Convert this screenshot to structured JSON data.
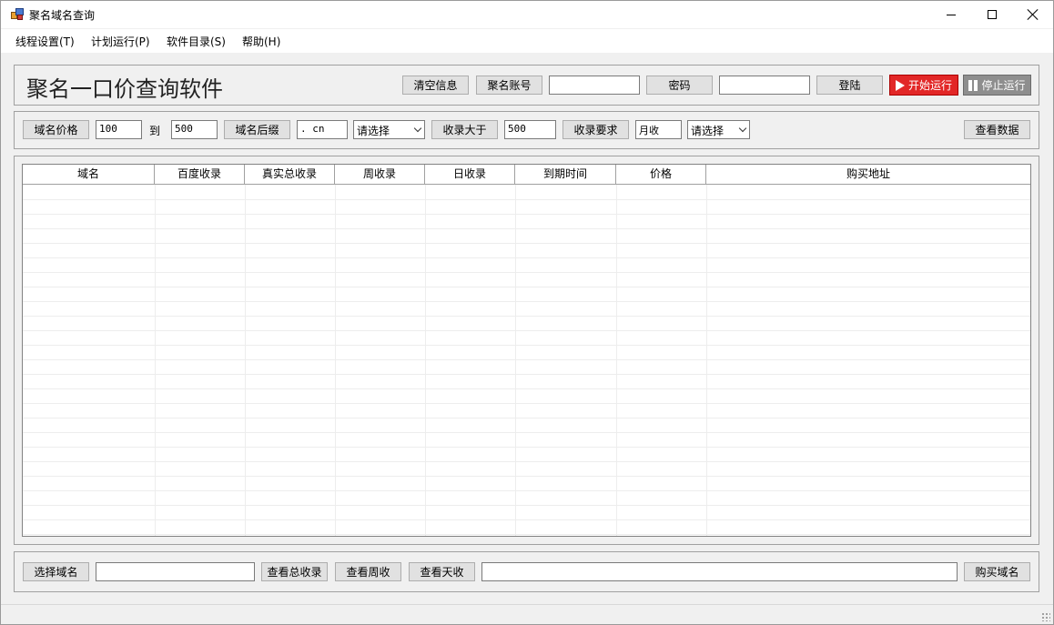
{
  "window": {
    "title": "聚名域名查询"
  },
  "menu": [
    {
      "label": "线程设置(T)"
    },
    {
      "label": "计划运行(P)"
    },
    {
      "label": "软件目录(S)"
    },
    {
      "label": "帮助(H)"
    }
  ],
  "header": {
    "app_title": "聚名一口价查询软件",
    "clear_label": "清空信息",
    "account_label": "聚名账号",
    "account_value": "",
    "password_label": "密码",
    "password_value": "",
    "login_label": "登陆",
    "start_label": "开始运行",
    "stop_label": "停止运行",
    "start_color": "#e22727",
    "stop_color": "#8e8e8e"
  },
  "filters": {
    "price_label": "域名价格",
    "price_min": "100",
    "to_label": "到",
    "price_max": "500",
    "suffix_label": "域名后缀",
    "suffix_value": ". cn",
    "suffix_select": "请选择",
    "index_gt_label": "收录大于",
    "index_gt_value": "500",
    "index_req_label": "收录要求",
    "index_req_value": "月收",
    "index_req_select": "请选择",
    "view_data_label": "查看数据"
  },
  "table": {
    "columns": [
      "域名",
      "百度收录",
      "真实总收录",
      "周收录",
      "日收录",
      "到期时间",
      "价格",
      "购买地址"
    ],
    "rows": []
  },
  "footer": {
    "select_domain_label": "选择域名",
    "select_domain_value": "",
    "view_total_label": "查看总收录",
    "view_week_label": "查看周收",
    "view_day_label": "查看天收",
    "buy_url_value": "",
    "buy_domain_label": "购买域名"
  }
}
